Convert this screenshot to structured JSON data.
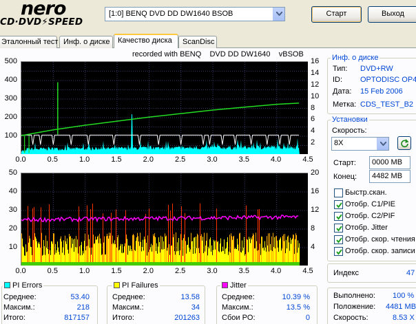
{
  "colors": {
    "pi_errors": "#00ffff",
    "pi_failures": "#ffff00",
    "jitter": "#ff00ff",
    "speed_line": "#22dd22",
    "accent": "#0046d5"
  },
  "logo": {
    "line1": "nero",
    "line2": "CD·DVD⚡SPEED"
  },
  "drive": {
    "selected": "[1:0]  BENQ DVD DD DW1640 BSOB"
  },
  "buttons": {
    "start": "Старт",
    "exit": "Выход"
  },
  "tabs": [
    {
      "label": "Эталонный тест"
    },
    {
      "label": "Инф. о диске"
    },
    {
      "label": "Качество диска"
    },
    {
      "label": "ScanDisc"
    }
  ],
  "disc_info": {
    "title": "Инф. о диске",
    "rows": [
      {
        "label": "Тип:",
        "value": "DVD+RW"
      },
      {
        "label": "ID:",
        "value": "OPTODISC OP4"
      },
      {
        "label": "Дата:",
        "value": "15 Feb 2006"
      },
      {
        "label": "Метка:",
        "value": "CDS_TEST_B2"
      }
    ]
  },
  "settings": {
    "title": "Установки",
    "speed_label": "Скорость:",
    "speed_value": "8X",
    "start_label": "Старт:",
    "start_value": "0000 MB",
    "end_label": "Конец:",
    "end_value": "4482 MB",
    "checkboxes": [
      {
        "label": "Быстр.скан.",
        "checked": false
      },
      {
        "label": "Отобр. C1/PIE",
        "checked": true
      },
      {
        "label": "Отобр. C2/PIF",
        "checked": true
      },
      {
        "label": "Отобр. Jitter",
        "checked": true
      },
      {
        "label": "Отобр. скор. чтения",
        "checked": true
      },
      {
        "label": "Отобр. скор. записи",
        "checked": true
      }
    ]
  },
  "index": {
    "label": "Индекс",
    "value": "47"
  },
  "progress": {
    "rows": [
      {
        "label": "Выполнено:",
        "value": "100 %"
      },
      {
        "label": "Положение:",
        "value": "4481 MB"
      },
      {
        "label": "Скорость:",
        "value": "8.53 X"
      }
    ]
  },
  "stats": {
    "pi_errors": {
      "title": "PI Errors",
      "rows": [
        {
          "label": "Среднее:",
          "value": "53.40"
        },
        {
          "label": "Максим.:",
          "value": "218"
        },
        {
          "label": "Итого:",
          "value": "817157"
        }
      ]
    },
    "pi_failures": {
      "title": "PI Failures",
      "rows": [
        {
          "label": "Среднее:",
          "value": "13.58"
        },
        {
          "label": "Максим.:",
          "value": "34"
        },
        {
          "label": "Итого:",
          "value": "201263"
        }
      ]
    },
    "jitter": {
      "title": "Jitter",
      "rows": [
        {
          "label": "Среднее:",
          "value": "10.39 %"
        },
        {
          "label": "Максим.:",
          "value": "13.5 %"
        },
        {
          "label": "Сбои PO:",
          "value": "0"
        }
      ]
    }
  },
  "chart_data": [
    {
      "type": "area",
      "title": "recorded with BENQ    DVD DD DW1640    vBSOB",
      "xlim": [
        0,
        4.5
      ],
      "ylim": [
        0,
        500
      ],
      "y2lim": [
        0,
        16
      ],
      "x_ticks": [
        "0.0",
        "0.5",
        "1.0",
        "1.5",
        "2.0",
        "2.5",
        "3.0",
        "3.5",
        "4.0",
        "4.5"
      ],
      "y_ticks": [
        "100",
        "200",
        "300",
        "400",
        "500"
      ],
      "y2_ticks": [
        "2",
        "4",
        "6",
        "8",
        "10",
        "12",
        "14",
        "16"
      ],
      "series": [
        {
          "name": "PI Errors",
          "typical": 45,
          "max": 218
        },
        {
          "values_x": [
            0.0,
            0.25,
            0.5,
            1.0,
            1.5,
            2.0,
            2.5,
            3.0,
            3.5,
            4.0,
            4.35
          ],
          "values_y": [
            3.3,
            3.8,
            4.3,
            5.1,
            5.8,
            6.5,
            7.1,
            7.7,
            8.2,
            8.7,
            8.9
          ]
        }
      ]
    },
    {
      "type": "bar",
      "xlim": [
        0,
        4.5
      ],
      "ylim": [
        0,
        50
      ],
      "y2lim": [
        0,
        20
      ],
      "x_ticks": [
        "0.0",
        "0.5",
        "1.0",
        "1.5",
        "2.0",
        "2.5",
        "3.0",
        "3.5",
        "4.0",
        "4.5"
      ],
      "y_ticks": [
        "10",
        "20",
        "30",
        "40",
        "50"
      ],
      "y2_ticks": [
        "4",
        "8",
        "12",
        "16",
        "20"
      ],
      "series": [
        {
          "name": "PI Failures",
          "typical": 14,
          "max": 34
        },
        {
          "name": "Jitter",
          "start": 10.0,
          "end": 10.6
        }
      ]
    }
  ]
}
